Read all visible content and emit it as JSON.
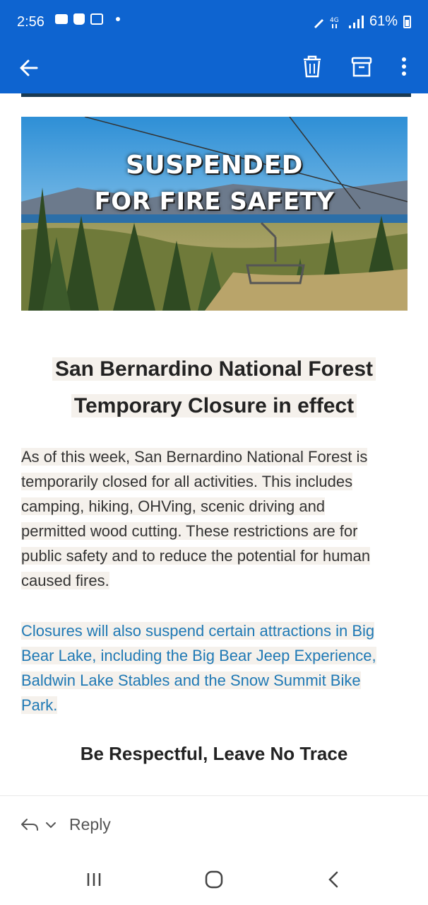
{
  "status_bar": {
    "time": "2:56",
    "signal_label": "4G",
    "battery": "61%"
  },
  "app_bar": {
    "icons": [
      "back-arrow-icon",
      "trash-icon",
      "archive-icon",
      "more-vert-icon"
    ]
  },
  "email": {
    "banner": {
      "line1": "SUSPENDED",
      "line2": "FOR FIRE SAFETY"
    },
    "heading_line1": "San Bernardino National Forest",
    "heading_line2": "Temporary Closure in effect",
    "paragraph1": [
      "As of this week, San Bernardino National Forest is",
      "temporarily closed for all activities. This includes",
      "camping, hiking, OHVing, scenic driving and",
      "permitted wood cutting. These restrictions are for",
      "public safety and to reduce the potential for human",
      "caused fires."
    ],
    "paragraph2": [
      "Closures will also suspend certain attractions in Big",
      "Bear Lake, including the Big Bear Jeep Experience,",
      "Baldwin Lake Stables and the Snow Summit Bike",
      "Park."
    ],
    "tagline": "Be Respectful, Leave No Trace"
  },
  "reply_bar": {
    "reply_label": "Reply"
  },
  "colors": {
    "app_bar": "#0e64d0",
    "link_text": "#1f79b5",
    "text_highlight": "#f5f1ec"
  }
}
